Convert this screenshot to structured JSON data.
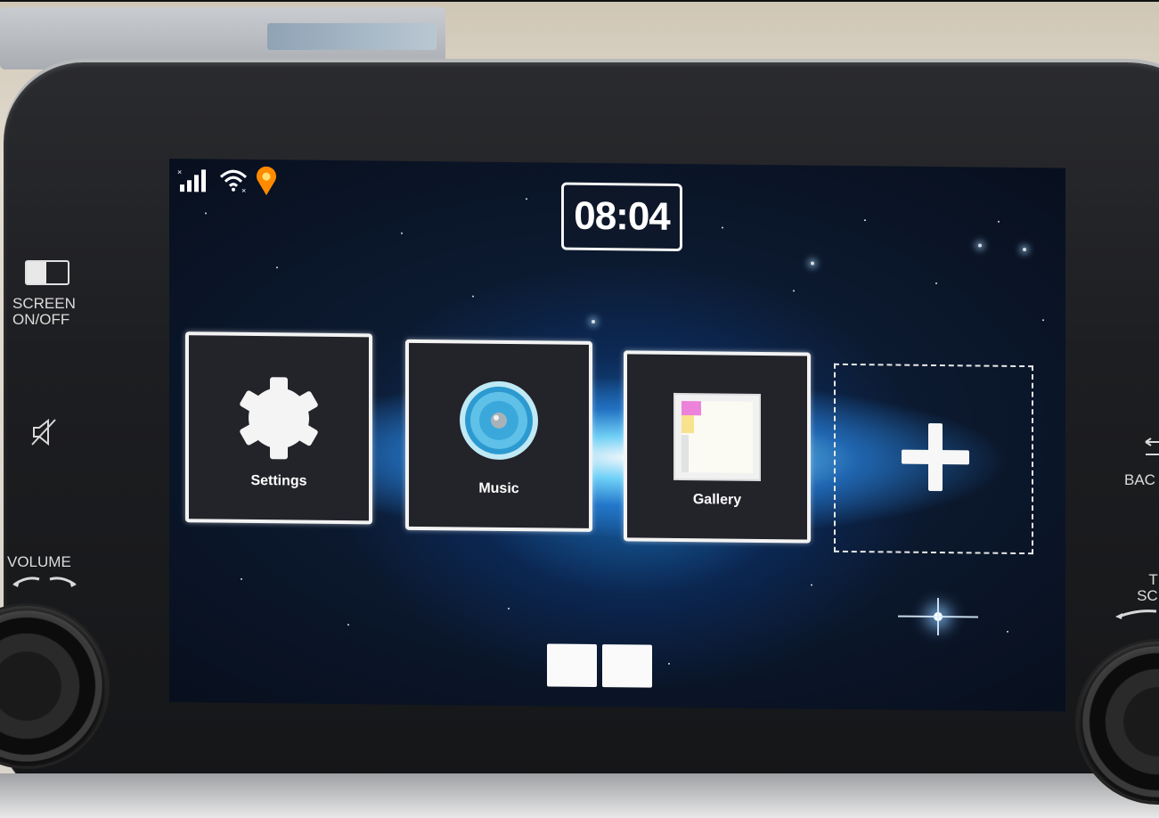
{
  "status_bar": {
    "signal_icon": "cellular-signal-no-sim-icon",
    "wifi_icon": "wifi-disconnected-icon",
    "location_icon": "location-pin-icon",
    "location_color": "#ff8a00"
  },
  "clock": {
    "time": "08:04"
  },
  "apps": [
    {
      "label": "Settings",
      "icon": "gear-icon"
    },
    {
      "label": "Music",
      "icon": "speaker-icon"
    },
    {
      "label": "Gallery",
      "icon": "picture-frame-icon"
    }
  ],
  "add_tile": {
    "icon": "plus-icon"
  },
  "pages": {
    "count": 2
  },
  "hardware": {
    "screen_label_line1": "SCREEN",
    "screen_label_line2": "ON/OFF",
    "mute_icon": "mute-speaker-icon",
    "volume_label": "VOLUME",
    "back_label": "BAC",
    "tune_label_line1": "TU",
    "tune_label_line2": "SCR"
  },
  "colors": {
    "tile_border": "#f3f3f3",
    "tile_background": "#23232a",
    "accent_blue": "#2fa8e8"
  }
}
